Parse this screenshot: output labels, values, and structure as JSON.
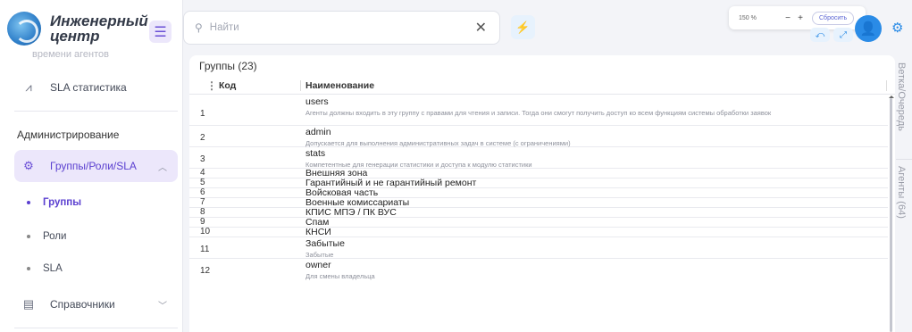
{
  "brand": {
    "name": "Инженерный центр"
  },
  "sidebar": {
    "faded_item": "времени агентов",
    "sla_stats": "SLA статистика",
    "section_title": "Администрирование",
    "active_group": "Группы/Роли/SLA",
    "sub_items": [
      "Группы",
      "Роли",
      "SLA"
    ],
    "references": "Справочники"
  },
  "search": {
    "placeholder": "Найти"
  },
  "zoom": {
    "percent": "150 %",
    "reset_label": "Сбросить"
  },
  "table": {
    "heading": "Группы (23)",
    "col_code": "Код",
    "col_name": "Наименование",
    "rows": [
      {
        "id": "1",
        "title": "users",
        "desc": "Агенты должны входить в эту группу с правами для чтения и записи. Тогда они смогут получить доступ ко всем функциям системы обработки заявок"
      },
      {
        "id": "2",
        "title": "admin",
        "desc": "Допускается для выполнения административных задач в системе (с ограничениями)"
      },
      {
        "id": "3",
        "title": "stats",
        "desc": "Компетентные для генерации статистики и доступа к модулю статистики"
      },
      {
        "id": "4",
        "title": "Внешняя зона",
        "desc": ""
      },
      {
        "id": "5",
        "title": "Гарантийный и не гарантийный ремонт",
        "desc": ""
      },
      {
        "id": "6",
        "title": "Войсковая часть",
        "desc": ""
      },
      {
        "id": "7",
        "title": "Военные комиссариаты",
        "desc": ""
      },
      {
        "id": "8",
        "title": "КПИС МПЭ / ПК ВУС",
        "desc": ""
      },
      {
        "id": "9",
        "title": "Спам",
        "desc": ""
      },
      {
        "id": "10",
        "title": "КНСИ",
        "desc": ""
      },
      {
        "id": "11",
        "title": "Забытые",
        "desc": "Забытые"
      },
      {
        "id": "12",
        "title": "owner",
        "desc": "Для смены владельца"
      }
    ]
  },
  "right_tabs": [
    "Ветка/Очередь",
    "Агенты (64)"
  ]
}
